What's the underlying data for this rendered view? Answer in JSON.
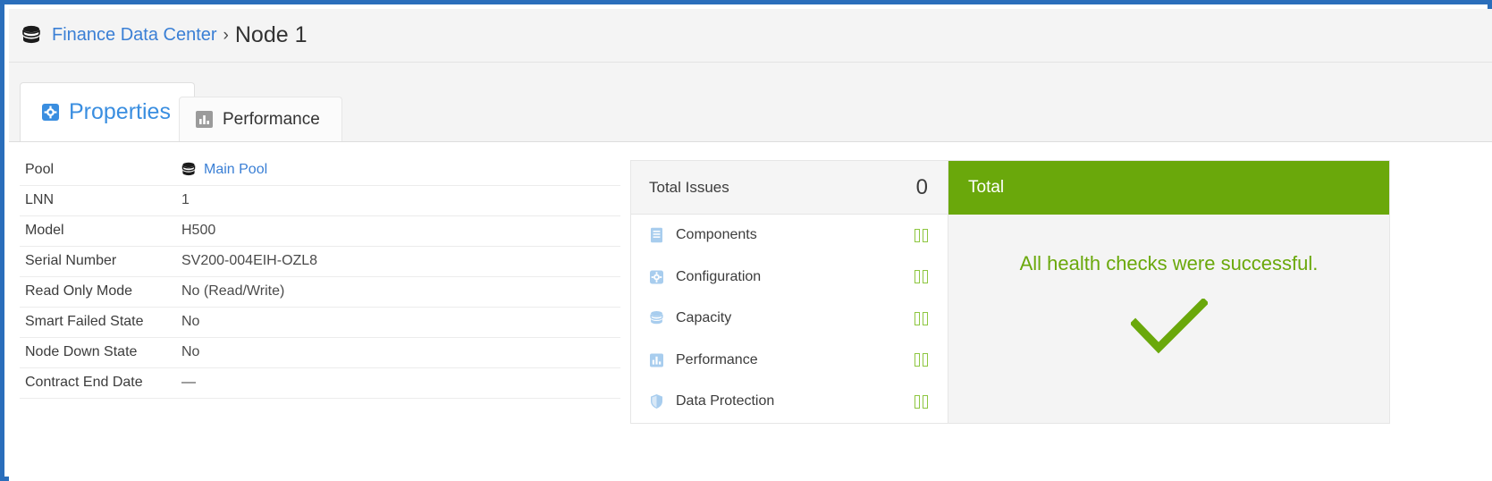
{
  "breadcrumb": {
    "icon": "cluster-icon",
    "parent": "Finance Data Center",
    "separator": "›",
    "current": "Node 1"
  },
  "tabs": [
    {
      "label": "Properties",
      "icon": "gear-icon",
      "active": true
    },
    {
      "label": "Performance",
      "icon": "bar-chart-icon",
      "active": false
    }
  ],
  "properties": {
    "rows": [
      {
        "key": "Pool",
        "value": "Main Pool",
        "is_link": true,
        "icon": "cluster-icon"
      },
      {
        "key": "LNN",
        "value": "1"
      },
      {
        "key": "Model",
        "value": "H500"
      },
      {
        "key": "Serial Number",
        "value": "SV200-004EIH-OZL8"
      },
      {
        "key": "Read Only Mode",
        "value": "No (Read/Write)"
      },
      {
        "key": "Smart Failed State",
        "value": "No"
      },
      {
        "key": "Node Down State",
        "value": "No"
      },
      {
        "key": "Contract End Date",
        "value": "—"
      }
    ]
  },
  "issues": {
    "header_label": "Total Issues",
    "header_value": "0",
    "rows": [
      {
        "label": "Components",
        "icon": "document-icon",
        "status": "ok"
      },
      {
        "label": "Configuration",
        "icon": "gear-icon",
        "status": "ok"
      },
      {
        "label": "Capacity",
        "icon": "cluster-icon",
        "status": "ok"
      },
      {
        "label": "Performance",
        "icon": "bar-chart-icon",
        "status": "ok"
      },
      {
        "label": "Data Protection",
        "icon": "shield-icon",
        "status": "ok"
      }
    ]
  },
  "total": {
    "header_label": "Total",
    "message": "All health checks were successful.",
    "icon": "checkmark-icon"
  },
  "colors": {
    "accent_blue": "#3a7fd5",
    "frame_blue": "#2a6ebb",
    "success_green": "#6aa80b",
    "status_green": "#8dc63f",
    "icon_blue": "#a8cdee"
  }
}
